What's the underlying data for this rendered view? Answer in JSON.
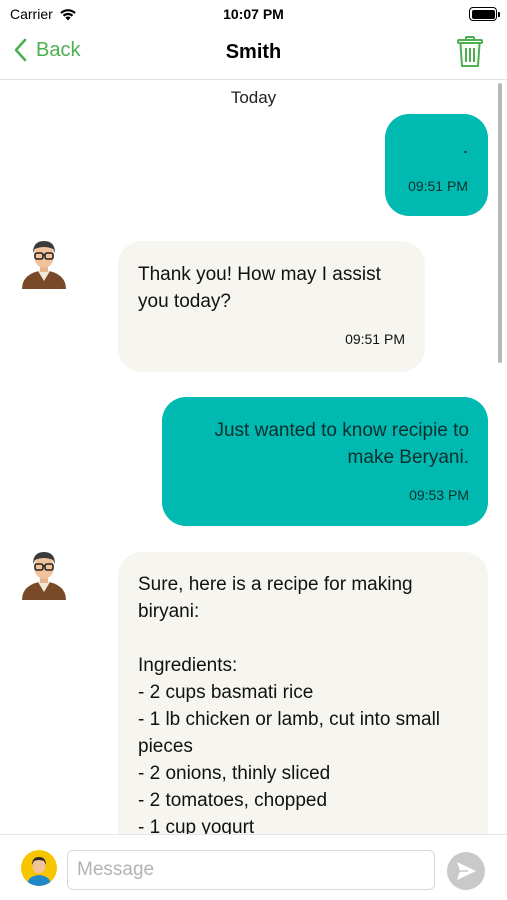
{
  "status_bar": {
    "carrier": "Carrier",
    "time": "10:07 PM"
  },
  "nav": {
    "back_label": "Back",
    "title": "Smith"
  },
  "chat": {
    "date_header": "Today",
    "messages": [
      {
        "direction": "outgoing",
        "text": ".",
        "time": "09:51 PM"
      },
      {
        "direction": "incoming",
        "text": "Thank you! How may I assist you today?",
        "time": "09:51 PM"
      },
      {
        "direction": "outgoing",
        "text": "Just wanted to know recipie to make Beryani.",
        "time": "09:53 PM"
      },
      {
        "direction": "incoming",
        "text": "Sure, here is a recipe for making biryani:\n\nIngredients:\n- 2 cups basmati rice\n- 1 lb chicken or lamb, cut into small pieces\n- 2 onions, thinly sliced\n- 2 tomatoes, chopped\n- 1 cup yogurt",
        "time": ""
      }
    ]
  },
  "composer": {
    "placeholder": "Message"
  },
  "colors": {
    "accent": "#4caf50",
    "outgoing_bubble": "#00b9b0",
    "incoming_bubble": "#f6f5f0"
  },
  "icons": [
    "wifi-icon",
    "battery-icon",
    "chevron-left-icon",
    "trash-icon",
    "user-avatar-icon",
    "send-icon"
  ]
}
